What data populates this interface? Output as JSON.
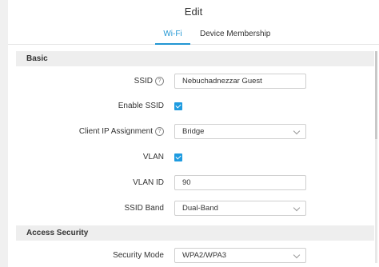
{
  "dialog": {
    "title": "Edit"
  },
  "tabs": [
    {
      "label": "Wi-Fi",
      "active": true
    },
    {
      "label": "Device Membership",
      "active": false
    }
  ],
  "basic": {
    "header": "Basic",
    "ssid": {
      "label": "SSID",
      "value": "Nebuchadnezzar Guest",
      "help_icon": "question-circle-icon"
    },
    "enable_ssid": {
      "label": "Enable SSID",
      "checked": true
    },
    "client_ip": {
      "label": "Client IP Assignment",
      "value": "Bridge",
      "help_icon": "question-circle-icon"
    },
    "vlan": {
      "label": "VLAN",
      "checked": true
    },
    "vlan_id": {
      "label": "VLAN ID",
      "value": "90"
    },
    "ssid_band": {
      "label": "SSID Band",
      "value": "Dual-Band"
    }
  },
  "access_security": {
    "header": "Access Security",
    "security_mode": {
      "label": "Security Mode",
      "value": "WPA2/WPA3"
    }
  },
  "colors": {
    "accent": "#2196d3",
    "checkbox": "#1e9be0",
    "section_bg": "#eeeeee"
  }
}
